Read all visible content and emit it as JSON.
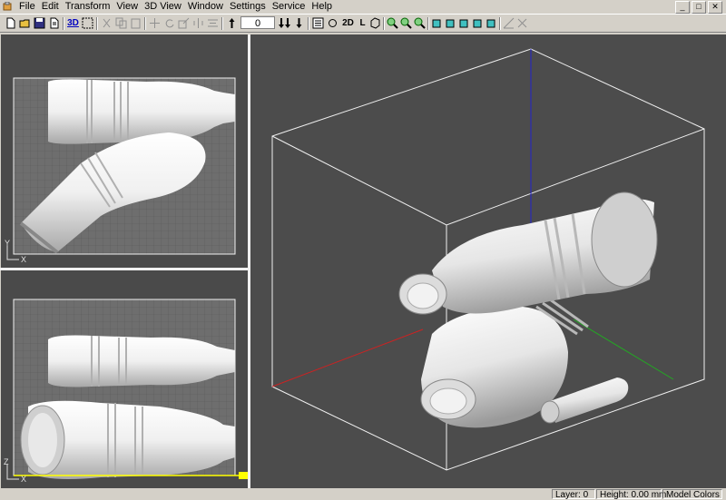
{
  "menu": {
    "items": [
      "File",
      "Edit",
      "Transform",
      "View",
      "3D View",
      "Window",
      "Settings",
      "Service",
      "Help"
    ]
  },
  "window_controls": [
    "_",
    "□",
    "✕"
  ],
  "toolbar": {
    "view3d_label": "3D",
    "view2d_label": "2D",
    "layer_label": "L",
    "layer_value": "0",
    "icons": [
      "new-file-icon",
      "open-folder-icon",
      "save-icon",
      "save-as-icon",
      "view-3d-icon",
      "select-icon",
      "cut-icon",
      "copy-icon",
      "paste-icon",
      "move-icon",
      "rotate-icon",
      "scale-icon",
      "mirror-icon",
      "align-icon",
      "layer-up-icon",
      "layer-up-all-icon",
      "layer-down-all-icon",
      "layer-down-icon",
      "slice-view-icon",
      "zoom-in-icon",
      "zoom-out-icon",
      "zoom-fit-icon",
      "cube-front-icon",
      "cube-side-icon",
      "cube-top-icon",
      "cube-iso-icon",
      "cube-iso2-icon",
      "measure-icon",
      "support-icon"
    ]
  },
  "views": {
    "top": {
      "axes": [
        "Y",
        "X"
      ]
    },
    "front": {
      "axes": [
        "Z",
        "X"
      ]
    }
  },
  "colors": {
    "viewport_bg": "#4a4a4a",
    "grid_bg": "#6e6e6e",
    "axis_x": "#cc2222",
    "axis_y": "#22aa22",
    "axis_z": "#2222cc",
    "layer_line": "#ffff00"
  },
  "status": {
    "layer": "Layer: 0",
    "height": "Height: 0.00 mm",
    "model_colors": "Model Colors"
  }
}
